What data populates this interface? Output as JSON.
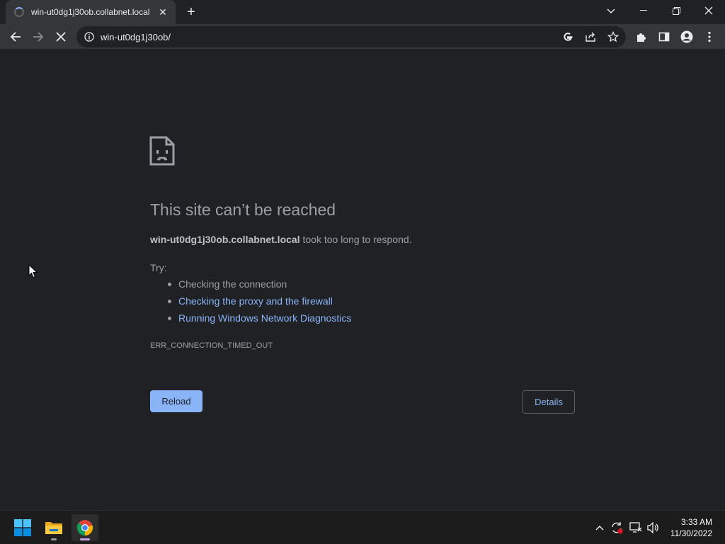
{
  "browser": {
    "tab": {
      "title": "win-ut0dg1j30ob.collabnet.local",
      "close_glyph": "✕"
    },
    "new_tab_glyph": "+",
    "window_controls": {
      "minimize": "—",
      "maximize": "❐",
      "close": "✕"
    },
    "omnibox": {
      "url": "win-ut0dg1j30ob/"
    }
  },
  "error_page": {
    "heading": "This site can’t be reached",
    "host": "win-ut0dg1j30ob.collabnet.local",
    "message": " took too long to respond.",
    "try_label": "Try:",
    "suggestions": [
      "Checking the connection",
      "Checking the proxy and the firewall",
      "Running Windows Network Diagnostics"
    ],
    "error_code": "ERR_CONNECTION_TIMED_OUT",
    "reload_label": "Reload",
    "details_label": "Details"
  },
  "taskbar": {
    "time": "3:33 AM",
    "date": "11/30/2022"
  },
  "colors": {
    "page_bg": "#202124",
    "toolbar_bg": "#35363a",
    "link": "#8ab4f8",
    "text_muted": "#9aa0a6"
  }
}
